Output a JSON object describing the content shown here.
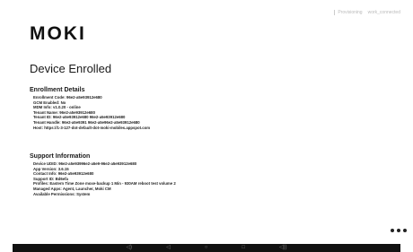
{
  "status": {
    "left": "Provisioning",
    "right": "work_connected"
  },
  "brand": {
    "logo_text": "MOKI"
  },
  "page_title": "Device Enrolled",
  "enrollment": {
    "heading": "Enrollment Details",
    "rows": [
      {
        "k": "Enrollment Code",
        "v": "96e2-a5e93912e680"
      },
      {
        "k": "GCM Enabled",
        "v": "No"
      },
      {
        "k": "MDM Info",
        "v": "v1.0.20 - online"
      },
      {
        "k": "Tenant Name",
        "v": "96e2-a5e93912e680"
      },
      {
        "k": "Tenant ID",
        "v": "96e2-a5e93912e680 96e2-a5e93912e680"
      },
      {
        "k": "Tenant Handle",
        "v": "96e2-a5e9391 96e2-a5e96e2-a5e93912e680"
      },
      {
        "k": "Host",
        "v": "https://1-3-127-dot-default-dot-moki-mobiles.appspot.com"
      }
    ]
  },
  "support": {
    "heading": "Support Information",
    "rows": [
      {
        "k": "Device UDID",
        "v": "96e2-a5e93996e2-a5e9-96e2-a5e93912e680"
      },
      {
        "k": "App Version",
        "v": "3.6.15"
      },
      {
        "k": "Contact Info",
        "v": "96e2-a5e93912e680"
      },
      {
        "k": "Support ID",
        "v": "Bd6efa"
      },
      {
        "k": "Profiles",
        "v": "Eastern Time Zone moxe-backup 1 Min - 930AM reboot test volume 2"
      },
      {
        "k": "Managed Apps",
        "v": "Agent, Launcher, Moki CM"
      },
      {
        "k": "Available Permissions",
        "v": "System"
      }
    ]
  },
  "nav_icons": [
    "volume-down-icon",
    "back-icon",
    "home-icon",
    "recents-icon",
    "volume-up-icon"
  ]
}
